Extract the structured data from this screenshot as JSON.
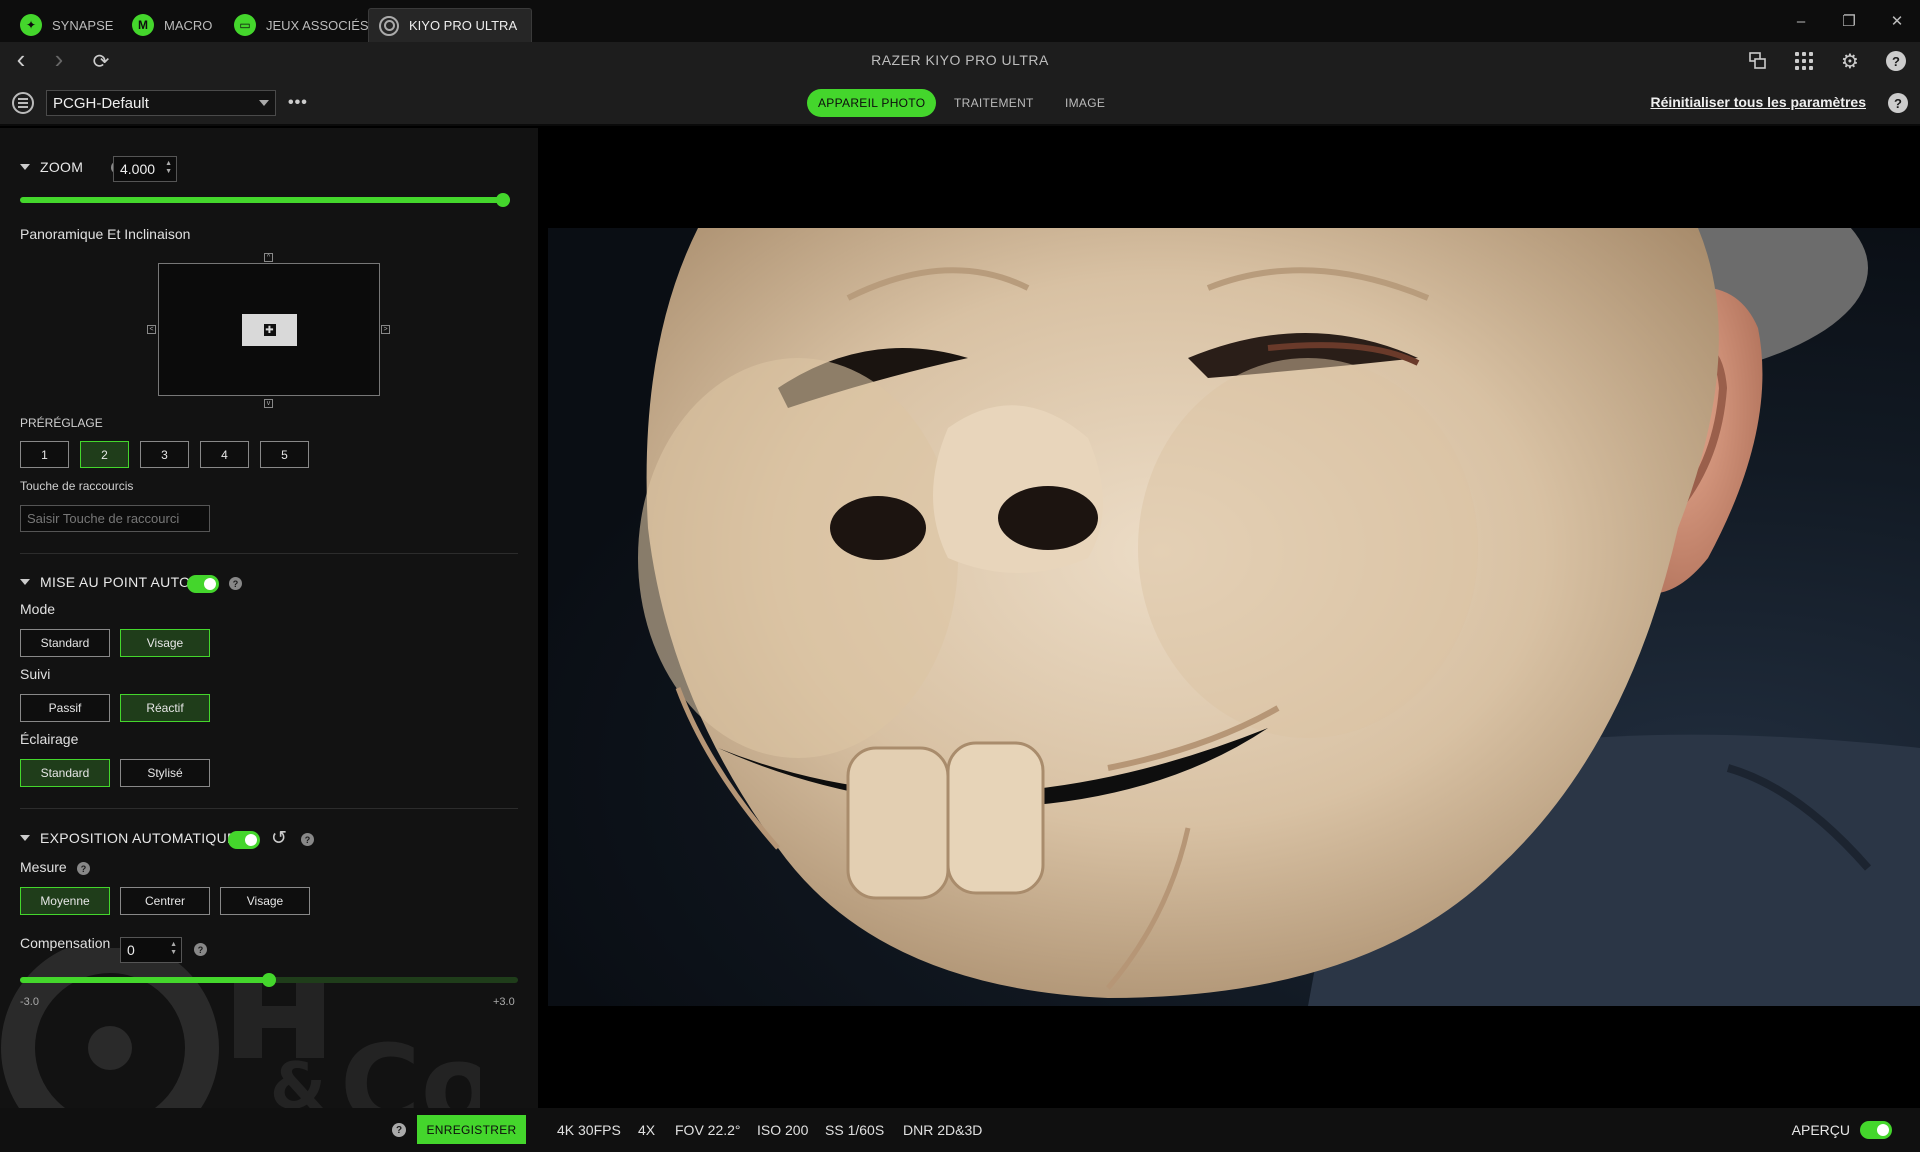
{
  "app_tabs": [
    {
      "label": "SYNAPSE",
      "icon": "razer-logo-icon"
    },
    {
      "label": "MACRO",
      "icon": "macro-icon"
    },
    {
      "label": "JEUX ASSOCIÉS",
      "icon": "gamepad-icon"
    },
    {
      "label": "KIYO PRO ULTRA",
      "icon": "webcam-icon"
    }
  ],
  "window_controls": {
    "minimize": "–",
    "restore": "❐",
    "close": "✕"
  },
  "nav": {
    "device_title": "RAZER KIYO PRO ULTRA",
    "back": "‹",
    "forward": "›",
    "refresh": "⟳"
  },
  "toolbar": {
    "profile_value": "PCGH-Default",
    "more": "•••",
    "tabs": [
      "APPAREIL PHOTO",
      "TRAITEMENT",
      "IMAGE"
    ],
    "active_tab": "APPAREIL PHOTO",
    "reset_link": "Réinitialiser tous les paramètres",
    "help": "?"
  },
  "zoom": {
    "title": "ZOOM",
    "value": "4.000",
    "slider_fraction": 1.0
  },
  "pan_tilt": {
    "title": "Panoramique Et Inclinaison"
  },
  "preset": {
    "title": "PRÉRÉGLAGE",
    "buttons": [
      "1",
      "2",
      "3",
      "4",
      "5"
    ],
    "selected": "2",
    "shortcut_label": "Touche de raccourcis",
    "shortcut_placeholder": "Saisir Touche de raccourci"
  },
  "autofocus": {
    "title": "MISE AU POINT AUTO",
    "enabled": true,
    "mode_label": "Mode",
    "mode_options": [
      "Standard",
      "Visage"
    ],
    "mode_selected": "Visage",
    "tracking_label": "Suivi",
    "tracking_options": [
      "Passif",
      "Réactif"
    ],
    "tracking_selected": "Réactif",
    "lighting_label": "Éclairage",
    "lighting_options": [
      "Standard",
      "Stylisé"
    ],
    "lighting_selected": "Standard"
  },
  "autoexposure": {
    "title": "EXPOSITION AUTOMATIQUE",
    "enabled": true,
    "metering_label": "Mesure",
    "metering_options": [
      "Moyenne",
      "Centrer",
      "Visage"
    ],
    "metering_selected": "Moyenne",
    "compensation_label": "Compensation",
    "compensation_value": "0",
    "slider_fraction": 0.5,
    "min_label": "-3.0",
    "max_label": "+3.0"
  },
  "bottom": {
    "save_label": "ENREGISTRER",
    "help": "?",
    "stats": [
      "4K 30FPS",
      "4X",
      "FOV 22.2°",
      "ISO 200",
      "SS 1/60S",
      "DNR 2D&3D"
    ],
    "preview_label": "APERÇU",
    "preview_enabled": true
  },
  "colors": {
    "accent": "#44d62c",
    "panel": "#121212",
    "bar": "#1d1d1d"
  }
}
